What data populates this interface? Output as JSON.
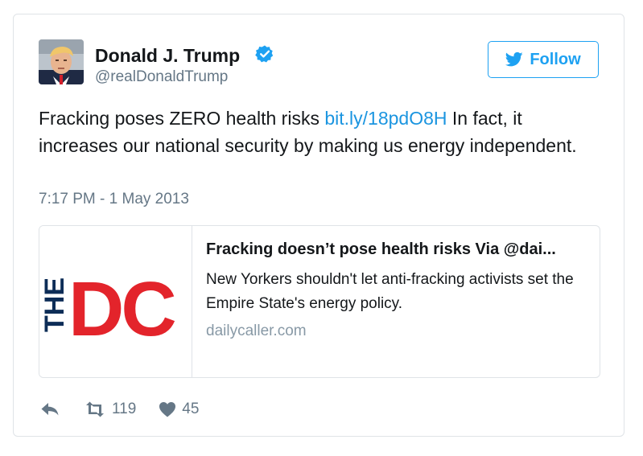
{
  "author": {
    "display_name": "Donald J. Trump",
    "handle": "@realDonaldTrump",
    "verified": true
  },
  "follow_button": {
    "label": "Follow",
    "icon": "twitter-bird-icon"
  },
  "tweet": {
    "text_before": "Fracking poses ZERO health risks ",
    "link_text": "bit.ly/18pdO8H",
    "text_after": " In fact, it increases our national security by making us energy independent.",
    "timestamp": "7:17 PM - 1 May 2013"
  },
  "link_card": {
    "thumbnail_logo_small": "THE",
    "thumbnail_logo_large": "DC",
    "title": "Fracking doesn’t pose health risks Via @dai...",
    "description": "New Yorkers shouldn't let anti-fracking activists set the Empire State's energy policy.",
    "domain": "dailycaller.com"
  },
  "actions": {
    "reply_icon": "reply-icon",
    "retweet_icon": "retweet-icon",
    "retweet_count": "119",
    "like_icon": "heart-icon",
    "like_count": "45"
  },
  "colors": {
    "accent": "#1da1f2",
    "link": "#1b95e0",
    "secondary_text": "#657786",
    "border": "#dfe3e7",
    "dc_red": "#e3242b",
    "dc_navy": "#0d2d57"
  }
}
